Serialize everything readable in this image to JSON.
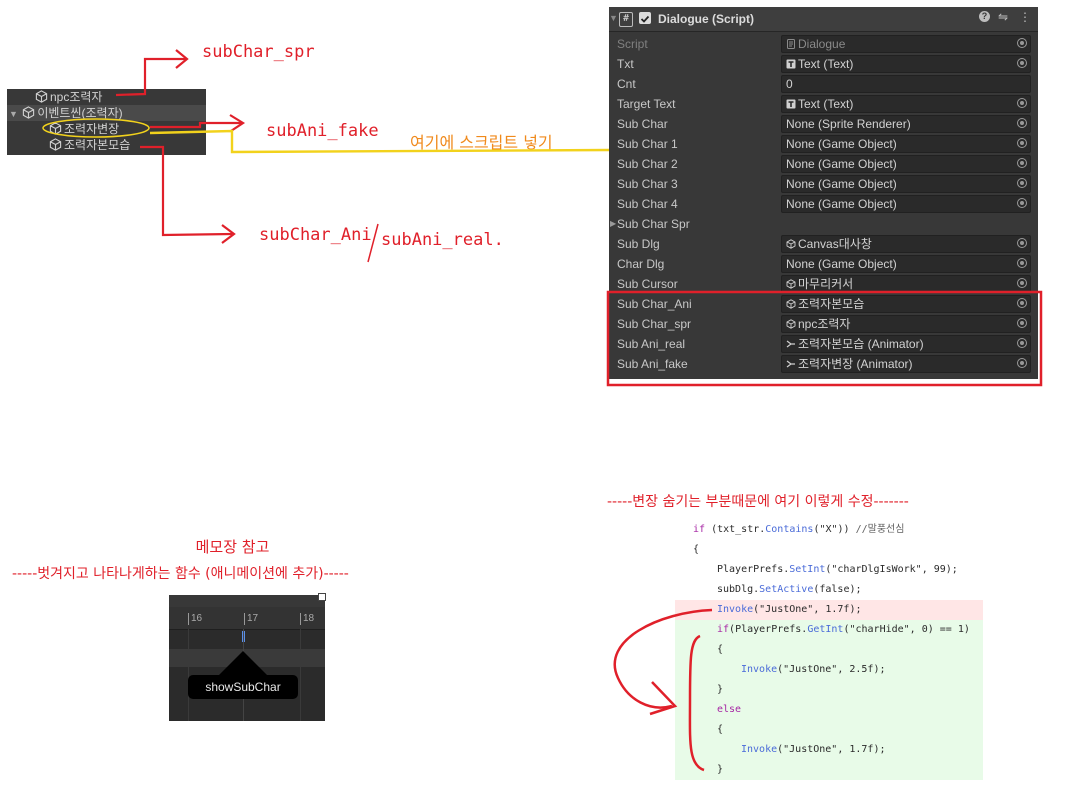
{
  "annotations": {
    "subchar_spr": "subChar_spr",
    "subani_fake": "subAni_fake",
    "insert_script": "여기에 스크립트 넣기",
    "subchar_ani": "subChar_Ani",
    "subani_real": "subAni_real."
  },
  "hierarchy": {
    "items": [
      {
        "label": "npc조력자",
        "indent": 1
      },
      {
        "label": "이벤트씬(조력자)",
        "indent": 0,
        "expanded": true
      },
      {
        "label": "조력자변장",
        "indent": 2,
        "circled": true
      },
      {
        "label": "조력자본모습",
        "indent": 2
      }
    ]
  },
  "inspector": {
    "component_title": "Dialogue (Script)",
    "rows": [
      {
        "label": "Script",
        "value": "Dialogue",
        "icon": "script-icon",
        "dim": true
      },
      {
        "label": "Txt",
        "value": "Text (Text)",
        "icon": "text-icon"
      },
      {
        "label": "Cnt",
        "value": "0",
        "plain": true
      },
      {
        "label": "Target Text",
        "value": "Text (Text)",
        "icon": "text-icon"
      },
      {
        "label": "Sub Char",
        "value": "None (Sprite Renderer)"
      },
      {
        "label": "Sub Char 1",
        "value": "None (Game Object)"
      },
      {
        "label": "Sub Char 2",
        "value": "None (Game Object)"
      },
      {
        "label": "Sub Char 3",
        "value": "None (Game Object)"
      },
      {
        "label": "Sub Char 4",
        "value": "None (Game Object)"
      },
      {
        "label": "Sub Char Spr",
        "foldout": true
      },
      {
        "label": "Sub Dlg",
        "value": "Canvas대사창",
        "icon": "cube-icon"
      },
      {
        "label": "Char Dlg",
        "value": "None (Game Object)"
      },
      {
        "label": "Sub Cursor",
        "value": "마무리커서",
        "icon": "cube-icon"
      },
      {
        "label": "Sub Char_Ani",
        "value": "조력자본모습",
        "icon": "cube-icon"
      },
      {
        "label": "Sub Char_spr",
        "value": "npc조력자",
        "icon": "cube-icon"
      },
      {
        "label": "Sub Ani_real",
        "value": "조력자본모습 (Animator)",
        "icon": "animator-icon"
      },
      {
        "label": "Sub Ani_fake",
        "value": "조력자변장 (Animator)",
        "icon": "animator-icon"
      }
    ]
  },
  "memo": {
    "title": "메모장 참고",
    "subtitle": "-----벗겨지고 나타나게하는 함수 (애니메이션에 추가)-----"
  },
  "timeline": {
    "ticks": [
      "16",
      "17",
      "18"
    ],
    "event_label": "showSubChar"
  },
  "code_note": {
    "title": "-----변장 숨기는 부분때문에 여기 이렇게 수정-------"
  },
  "code": {
    "lines": [
      {
        "parts": [
          [
            "kw",
            "if"
          ],
          [
            "p",
            " (txt_str."
          ],
          [
            "fn",
            "Contains"
          ],
          [
            "p",
            "(\"X\")) "
          ],
          [
            "cm",
            "//말풍선심"
          ]
        ],
        "indent": 0
      },
      {
        "parts": [
          [
            "p",
            "{"
          ]
        ],
        "indent": 0
      },
      {
        "parts": [
          [
            "p",
            "PlayerPrefs."
          ],
          [
            "fn",
            "SetInt"
          ],
          [
            "p",
            "(\"charDlgIsWork\", 99);"
          ]
        ],
        "indent": 1
      },
      {
        "parts": [
          [
            "p",
            "subDlg."
          ],
          [
            "fn",
            "SetActive"
          ],
          [
            "p",
            "(false);"
          ]
        ],
        "indent": 1
      },
      {
        "parts": [
          [
            "fn",
            "Invoke"
          ],
          [
            "p",
            "(\"JustOne\", 1.7f);"
          ]
        ],
        "indent": 1,
        "diff": "del"
      },
      {
        "parts": [
          [
            "kw",
            "if"
          ],
          [
            "p",
            "(PlayerPrefs."
          ],
          [
            "fn",
            "GetInt"
          ],
          [
            "p",
            "(\"charHide\", 0) == 1)"
          ]
        ],
        "indent": 1,
        "diff": "add"
      },
      {
        "parts": [
          [
            "p",
            "{"
          ]
        ],
        "indent": 1,
        "diff": "add"
      },
      {
        "parts": [
          [
            "fn",
            "Invoke"
          ],
          [
            "p",
            "(\"JustOne\", 2.5f);"
          ]
        ],
        "indent": 2,
        "diff": "add"
      },
      {
        "parts": [
          [
            "p",
            "}"
          ]
        ],
        "indent": 1,
        "diff": "add"
      },
      {
        "parts": [
          [
            "kw",
            "else"
          ]
        ],
        "indent": 1,
        "diff": "add"
      },
      {
        "parts": [
          [
            "p",
            "{"
          ]
        ],
        "indent": 1,
        "diff": "add"
      },
      {
        "parts": [
          [
            "fn",
            "Invoke"
          ],
          [
            "p",
            "(\"JustOne\", 1.7f);"
          ]
        ],
        "indent": 2,
        "diff": "add"
      },
      {
        "parts": [
          [
            "p",
            "}"
          ]
        ],
        "indent": 1,
        "diff": "add"
      }
    ]
  }
}
